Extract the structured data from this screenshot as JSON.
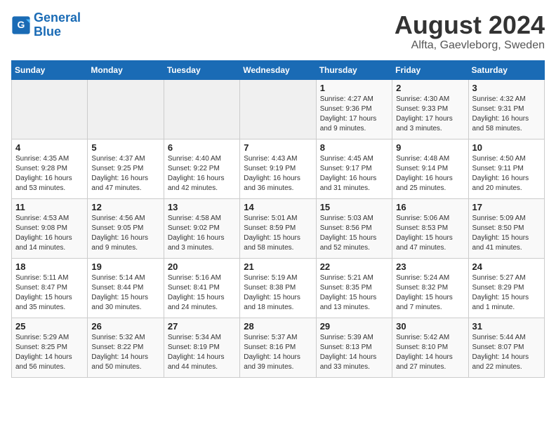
{
  "header": {
    "logo_line1": "General",
    "logo_line2": "Blue",
    "title": "August 2024",
    "subtitle": "Alfta, Gaevleborg, Sweden"
  },
  "weekdays": [
    "Sunday",
    "Monday",
    "Tuesday",
    "Wednesday",
    "Thursday",
    "Friday",
    "Saturday"
  ],
  "weeks": [
    [
      {
        "day": "",
        "info": ""
      },
      {
        "day": "",
        "info": ""
      },
      {
        "day": "",
        "info": ""
      },
      {
        "day": "",
        "info": ""
      },
      {
        "day": "1",
        "info": "Sunrise: 4:27 AM\nSunset: 9:36 PM\nDaylight: 17 hours\nand 9 minutes."
      },
      {
        "day": "2",
        "info": "Sunrise: 4:30 AM\nSunset: 9:33 PM\nDaylight: 17 hours\nand 3 minutes."
      },
      {
        "day": "3",
        "info": "Sunrise: 4:32 AM\nSunset: 9:31 PM\nDaylight: 16 hours\nand 58 minutes."
      }
    ],
    [
      {
        "day": "4",
        "info": "Sunrise: 4:35 AM\nSunset: 9:28 PM\nDaylight: 16 hours\nand 53 minutes."
      },
      {
        "day": "5",
        "info": "Sunrise: 4:37 AM\nSunset: 9:25 PM\nDaylight: 16 hours\nand 47 minutes."
      },
      {
        "day": "6",
        "info": "Sunrise: 4:40 AM\nSunset: 9:22 PM\nDaylight: 16 hours\nand 42 minutes."
      },
      {
        "day": "7",
        "info": "Sunrise: 4:43 AM\nSunset: 9:19 PM\nDaylight: 16 hours\nand 36 minutes."
      },
      {
        "day": "8",
        "info": "Sunrise: 4:45 AM\nSunset: 9:17 PM\nDaylight: 16 hours\nand 31 minutes."
      },
      {
        "day": "9",
        "info": "Sunrise: 4:48 AM\nSunset: 9:14 PM\nDaylight: 16 hours\nand 25 minutes."
      },
      {
        "day": "10",
        "info": "Sunrise: 4:50 AM\nSunset: 9:11 PM\nDaylight: 16 hours\nand 20 minutes."
      }
    ],
    [
      {
        "day": "11",
        "info": "Sunrise: 4:53 AM\nSunset: 9:08 PM\nDaylight: 16 hours\nand 14 minutes."
      },
      {
        "day": "12",
        "info": "Sunrise: 4:56 AM\nSunset: 9:05 PM\nDaylight: 16 hours\nand 9 minutes."
      },
      {
        "day": "13",
        "info": "Sunrise: 4:58 AM\nSunset: 9:02 PM\nDaylight: 16 hours\nand 3 minutes."
      },
      {
        "day": "14",
        "info": "Sunrise: 5:01 AM\nSunset: 8:59 PM\nDaylight: 15 hours\nand 58 minutes."
      },
      {
        "day": "15",
        "info": "Sunrise: 5:03 AM\nSunset: 8:56 PM\nDaylight: 15 hours\nand 52 minutes."
      },
      {
        "day": "16",
        "info": "Sunrise: 5:06 AM\nSunset: 8:53 PM\nDaylight: 15 hours\nand 47 minutes."
      },
      {
        "day": "17",
        "info": "Sunrise: 5:09 AM\nSunset: 8:50 PM\nDaylight: 15 hours\nand 41 minutes."
      }
    ],
    [
      {
        "day": "18",
        "info": "Sunrise: 5:11 AM\nSunset: 8:47 PM\nDaylight: 15 hours\nand 35 minutes."
      },
      {
        "day": "19",
        "info": "Sunrise: 5:14 AM\nSunset: 8:44 PM\nDaylight: 15 hours\nand 30 minutes."
      },
      {
        "day": "20",
        "info": "Sunrise: 5:16 AM\nSunset: 8:41 PM\nDaylight: 15 hours\nand 24 minutes."
      },
      {
        "day": "21",
        "info": "Sunrise: 5:19 AM\nSunset: 8:38 PM\nDaylight: 15 hours\nand 18 minutes."
      },
      {
        "day": "22",
        "info": "Sunrise: 5:21 AM\nSunset: 8:35 PM\nDaylight: 15 hours\nand 13 minutes."
      },
      {
        "day": "23",
        "info": "Sunrise: 5:24 AM\nSunset: 8:32 PM\nDaylight: 15 hours\nand 7 minutes."
      },
      {
        "day": "24",
        "info": "Sunrise: 5:27 AM\nSunset: 8:29 PM\nDaylight: 15 hours\nand 1 minute."
      }
    ],
    [
      {
        "day": "25",
        "info": "Sunrise: 5:29 AM\nSunset: 8:25 PM\nDaylight: 14 hours\nand 56 minutes."
      },
      {
        "day": "26",
        "info": "Sunrise: 5:32 AM\nSunset: 8:22 PM\nDaylight: 14 hours\nand 50 minutes."
      },
      {
        "day": "27",
        "info": "Sunrise: 5:34 AM\nSunset: 8:19 PM\nDaylight: 14 hours\nand 44 minutes."
      },
      {
        "day": "28",
        "info": "Sunrise: 5:37 AM\nSunset: 8:16 PM\nDaylight: 14 hours\nand 39 minutes."
      },
      {
        "day": "29",
        "info": "Sunrise: 5:39 AM\nSunset: 8:13 PM\nDaylight: 14 hours\nand 33 minutes."
      },
      {
        "day": "30",
        "info": "Sunrise: 5:42 AM\nSunset: 8:10 PM\nDaylight: 14 hours\nand 27 minutes."
      },
      {
        "day": "31",
        "info": "Sunrise: 5:44 AM\nSunset: 8:07 PM\nDaylight: 14 hours\nand 22 minutes."
      }
    ]
  ]
}
